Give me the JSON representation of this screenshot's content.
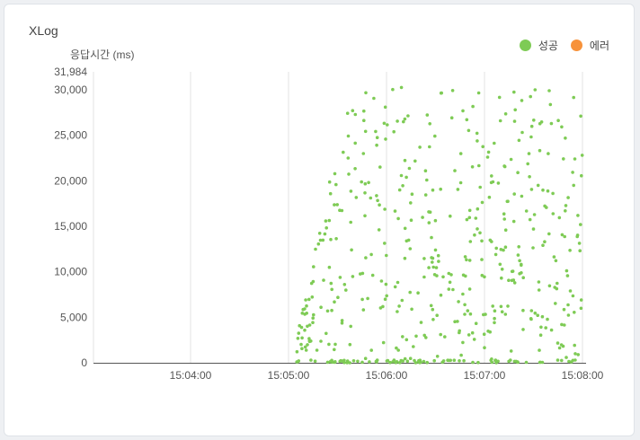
{
  "colors": {
    "success": "#7ecb55",
    "error": "#f7923a",
    "grid": "#e3e3e3",
    "axis": "#555555"
  },
  "chart_data": {
    "type": "scatter",
    "title": "XLog",
    "ylabel": "응답시간 (ms)",
    "xlabel": "",
    "ylim": [
      0,
      31984
    ],
    "y_max_label": "31,984",
    "y_ticks": [
      0,
      5000,
      10000,
      15000,
      20000,
      25000,
      30000
    ],
    "y_tick_labels": [
      "0",
      "5,000",
      "10,000",
      "15,000",
      "20,000",
      "25,000",
      "30,000"
    ],
    "x_unit": "seconds after 15:03:00",
    "x_ticks": [
      60,
      120,
      180,
      240,
      300
    ],
    "x_tick_labels": [
      "15:04:00",
      "15:05:00",
      "15:06:00",
      "15:07:00",
      "15:08:00"
    ],
    "xlim": [
      0,
      300
    ],
    "legend_placement": "top-right",
    "grid": true,
    "series": [
      {
        "name": "성공",
        "color_key": "success",
        "seed": 7,
        "count": 520,
        "x_range": [
          120,
          300
        ]
      },
      {
        "name": "에러",
        "color_key": "error",
        "seed": 3,
        "count": 0,
        "x_range": [
          120,
          300
        ]
      }
    ]
  }
}
